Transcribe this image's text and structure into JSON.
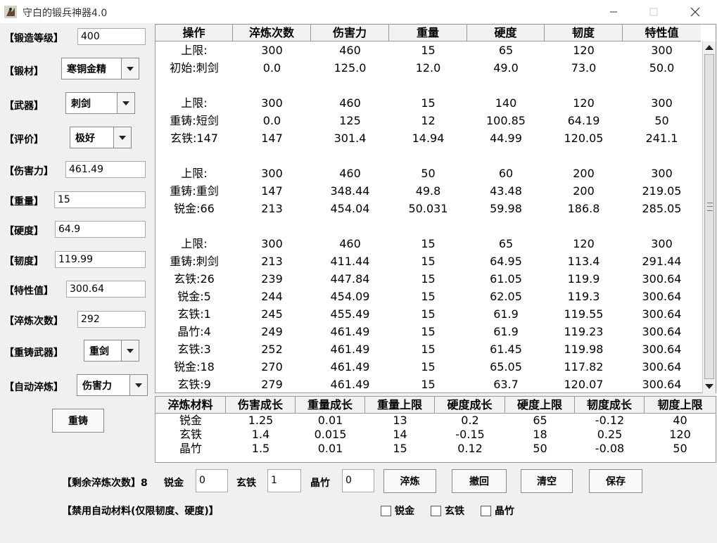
{
  "window": {
    "title": "守白的锻兵神器4.0"
  },
  "form": [
    {
      "label": "【锻造等级】",
      "type": "text",
      "value": "400"
    },
    {
      "label": "【锻材】",
      "type": "combo",
      "value": "寒铜金精"
    },
    {
      "label": "【武器】",
      "type": "combo",
      "value": "刺剑"
    },
    {
      "label": "【评价】",
      "type": "combo",
      "value": "极好"
    },
    {
      "label": "【伤害力】",
      "type": "text",
      "value": "461.49"
    },
    {
      "label": "【重量】",
      "type": "text",
      "value": "15"
    },
    {
      "label": "【硬度】",
      "type": "text",
      "value": "64.9"
    },
    {
      "label": "【韧度】",
      "type": "text",
      "value": "119.99"
    },
    {
      "label": "【特性值】",
      "type": "text",
      "value": "300.64"
    },
    {
      "label": "【淬炼次数】",
      "type": "text",
      "value": "292"
    },
    {
      "label": "【重铸武器】",
      "type": "combo",
      "value": "重剑"
    },
    {
      "label": "【自动淬炼】",
      "type": "combo",
      "value": "伤害力"
    }
  ],
  "recast_button": "重铸",
  "main_table": {
    "headers": [
      "操作",
      "淬炼次数",
      "伤害力",
      "重量",
      "硬度",
      "韧度",
      "特性值"
    ],
    "rows": [
      [
        "上限:",
        "300",
        "460",
        "15",
        "65",
        "120",
        "300"
      ],
      [
        "初始:刺剑",
        "0.0",
        "125.0",
        "12.0",
        "49.0",
        "73.0",
        "50.0"
      ],
      [
        "",
        "",
        "",
        "",
        "",
        "",
        ""
      ],
      [
        "上限:",
        "300",
        "460",
        "15",
        "140",
        "120",
        "300"
      ],
      [
        "重铸:短剑",
        "0.0",
        "125",
        "12",
        "100.85",
        "64.19",
        "50"
      ],
      [
        "玄铁:147",
        "147",
        "301.4",
        "14.94",
        "44.99",
        "120.05",
        "241.1"
      ],
      [
        "",
        "",
        "",
        "",
        "",
        "",
        ""
      ],
      [
        "上限:",
        "300",
        "460",
        "50",
        "60",
        "200",
        "300"
      ],
      [
        "重铸:重剑",
        "147",
        "348.44",
        "49.8",
        "43.48",
        "200",
        "219.05"
      ],
      [
        "锐金:66",
        "213",
        "454.04",
        "50.031",
        "59.98",
        "186.8",
        "285.05"
      ],
      [
        "",
        "",
        "",
        "",
        "",
        "",
        ""
      ],
      [
        "上限:",
        "300",
        "460",
        "15",
        "65",
        "120",
        "300"
      ],
      [
        "重铸:刺剑",
        "213",
        "411.44",
        "15",
        "64.95",
        "113.4",
        "291.44"
      ],
      [
        "玄铁:26",
        "239",
        "447.84",
        "15",
        "61.05",
        "119.9",
        "300.64"
      ],
      [
        "锐金:5",
        "244",
        "454.09",
        "15",
        "62.05",
        "119.3",
        "300.64"
      ],
      [
        "玄铁:1",
        "245",
        "455.49",
        "15",
        "61.9",
        "119.55",
        "300.64"
      ],
      [
        "晶竹:4",
        "249",
        "461.49",
        "15",
        "61.9",
        "119.23",
        "300.64"
      ],
      [
        "玄铁:3",
        "252",
        "461.49",
        "15",
        "61.45",
        "119.98",
        "300.64"
      ],
      [
        "锐金:18",
        "270",
        "461.49",
        "15",
        "65.05",
        "117.82",
        "300.64"
      ],
      [
        "玄铁:9",
        "279",
        "461.49",
        "15",
        "63.7",
        "120.07",
        "300.64"
      ]
    ]
  },
  "material_table": {
    "headers": [
      "淬炼材料",
      "伤害成长",
      "重量成长",
      "重量上限",
      "硬度成长",
      "硬度上限",
      "韧度成长",
      "韧度上限"
    ],
    "rows": [
      [
        "锐金",
        "1.25",
        "0.01",
        "13",
        "0.2",
        "65",
        "-0.12",
        "40"
      ],
      [
        "玄铁",
        "1.4",
        "0.015",
        "14",
        "-0.15",
        "18",
        "0.25",
        "120"
      ],
      [
        "晶竹",
        "1.5",
        "0.01",
        "15",
        "0.12",
        "50",
        "-0.08",
        "50"
      ]
    ]
  },
  "bottom": {
    "remaining_label": "【剩余淬炼次数】8",
    "mat_inputs": [
      {
        "label": "锐金",
        "value": "0"
      },
      {
        "label": "玄铁",
        "value": "1"
      },
      {
        "label": "晶竹",
        "value": "0"
      }
    ],
    "buttons": [
      "淬炼",
      "撤回",
      "清空",
      "保存"
    ],
    "disable_label": "【禁用自动材料(仅限韧度、硬度)】",
    "checkboxes": [
      "锐金",
      "玄铁",
      "晶竹"
    ]
  },
  "icons": [
    "app-icon",
    "minimize-icon",
    "maximize-icon",
    "close-icon",
    "dropdown-arrow-icon",
    "scroll-up-icon",
    "scroll-down-icon"
  ]
}
